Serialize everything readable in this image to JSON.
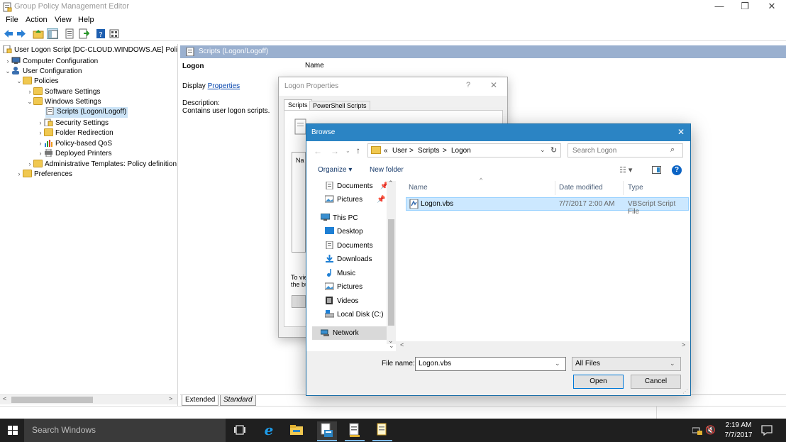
{
  "window": {
    "title": "Group Policy Management Editor",
    "min": "—",
    "max": "❐",
    "close": "✕"
  },
  "menu": [
    "File",
    "Action",
    "View",
    "Help"
  ],
  "tree": {
    "root": "User Logon Script [DC-CLOUD.WINDOWS.AE] Policy",
    "computer_configuration": "Computer Configuration",
    "user_configuration": "User Configuration",
    "policies": "Policies",
    "software_settings": "Software Settings",
    "windows_settings": "Windows Settings",
    "scripts": "Scripts (Logon/Logoff)",
    "security_settings": "Security Settings",
    "folder_redirection": "Folder Redirection",
    "policy_qos": "Policy-based QoS",
    "deployed_printers": "Deployed Printers",
    "admin_templates": "Administrative Templates: Policy definition",
    "preferences": "Preferences"
  },
  "right": {
    "header": "Scripts (Logon/Logoff)",
    "logon": "Logon",
    "display": "Display",
    "properties_link": "Properties",
    "description_label": "Description:",
    "description": "Contains user logon scripts.",
    "name_col": "Name",
    "tab_extended": "Extended",
    "tab_standard": "Standard"
  },
  "props": {
    "title": "Logon Properties",
    "help": "?",
    "close": "✕",
    "tab_scripts": "Scripts",
    "tab_ps": "PowerShell Scripts",
    "na": "Na",
    "to_view": "To vie",
    "the_bu": "the bu"
  },
  "browse": {
    "title": "Browse",
    "close": "✕",
    "breadcrumb": [
      "«",
      "User",
      ">",
      "Scripts",
      ">",
      "Logon"
    ],
    "search_placeholder": "Search Logon",
    "organize": "Organize ▾",
    "new_folder": "New folder",
    "nav": {
      "documents": "Documents",
      "pictures": "Pictures",
      "this_pc": "This PC",
      "desktop": "Desktop",
      "documents2": "Documents",
      "downloads": "Downloads",
      "music": "Music",
      "pictures2": "Pictures",
      "videos": "Videos",
      "local_disk": "Local Disk (C:)",
      "network": "Network"
    },
    "columns": {
      "name": "Name",
      "date": "Date modified",
      "type": "Type"
    },
    "file": {
      "name": "Logon.vbs",
      "date": "7/7/2017 2:00 AM",
      "type": "VBScript Script File"
    },
    "file_name_label": "File name:",
    "file_name_value": "Logon.vbs",
    "filter": "All Files",
    "open": "Open",
    "cancel": "Cancel"
  },
  "taskbar": {
    "search": "Search Windows",
    "time": "2:19 AM",
    "date": "7/7/2017"
  }
}
